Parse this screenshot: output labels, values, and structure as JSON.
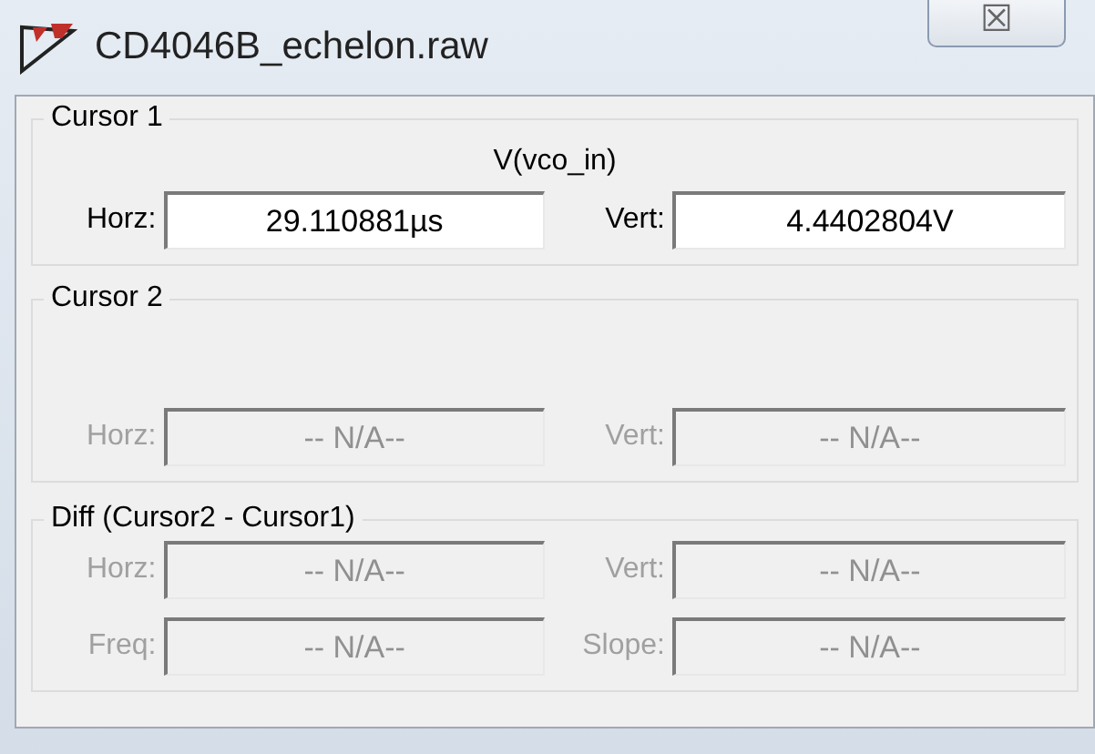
{
  "window": {
    "title": "CD4046B_echelon.raw",
    "close": "☒"
  },
  "groups": [
    {
      "legend": "Cursor 1",
      "signal": "V(vco_in)",
      "fields": [
        {
          "label": "Horz:",
          "value": "29.110881µs",
          "disabled": false
        },
        {
          "label": "Vert:",
          "value": "4.4402804V",
          "disabled": false
        }
      ]
    },
    {
      "legend": "Cursor 2",
      "fields": [
        {
          "label": "Horz:",
          "value": "-- N/A--",
          "disabled": true
        },
        {
          "label": "Vert:",
          "value": "-- N/A--",
          "disabled": true
        }
      ]
    },
    {
      "legend": "Diff (Cursor2 - Cursor1)",
      "fields": [
        {
          "label": "Horz:",
          "value": "-- N/A--",
          "disabled": true
        },
        {
          "label": "Vert:",
          "value": "-- N/A--",
          "disabled": true
        },
        {
          "label": "Freq:",
          "value": "-- N/A--",
          "disabled": true
        },
        {
          "label": "Slope:",
          "value": "-- N/A--",
          "disabled": true
        }
      ]
    }
  ]
}
